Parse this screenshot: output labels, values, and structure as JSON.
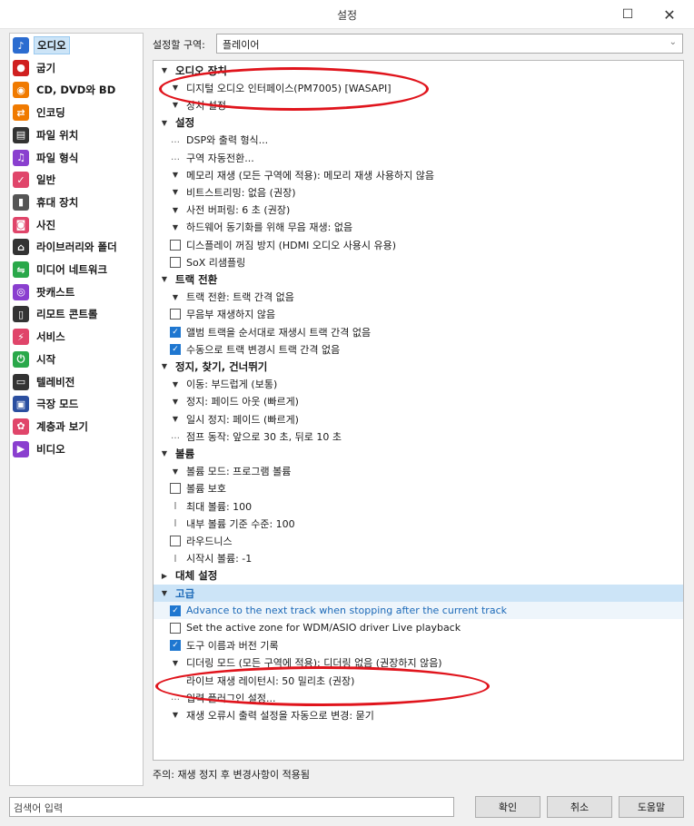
{
  "window": {
    "title": "설정",
    "maximize_icon": "☐",
    "close_icon": "✕"
  },
  "sidebar": {
    "items": [
      {
        "label": "오디오",
        "icon": "♪",
        "color": "#2b6cd0",
        "selected": true
      },
      {
        "label": "굽기",
        "icon": "●",
        "color": "#d02020"
      },
      {
        "label": "CD, DVD와 BD",
        "icon": "◉",
        "color": "#f07a00"
      },
      {
        "label": "인코딩",
        "icon": "⇄",
        "color": "#f07a00"
      },
      {
        "label": "파일 위치",
        "icon": "▤",
        "color": "#333333"
      },
      {
        "label": "파일 형식",
        "icon": "♫",
        "color": "#8a3fcf"
      },
      {
        "label": "일반",
        "icon": "✓",
        "color": "#e0456a"
      },
      {
        "label": "휴대 장치",
        "icon": "▮",
        "color": "#555555"
      },
      {
        "label": "사진",
        "icon": "◙",
        "color": "#e0456a"
      },
      {
        "label": "라이브러리와 폴더",
        "icon": "⌂",
        "color": "#333333"
      },
      {
        "label": "미디어 네트워크",
        "icon": "⇋",
        "color": "#2aa84a"
      },
      {
        "label": "팟캐스트",
        "icon": "◎",
        "color": "#8a3fcf"
      },
      {
        "label": "리모트 콘트롤",
        "icon": "▯",
        "color": "#333333"
      },
      {
        "label": "서비스",
        "icon": "⚡",
        "color": "#e0456a"
      },
      {
        "label": "시작",
        "icon": "⏻",
        "color": "#2aa84a"
      },
      {
        "label": "텔레비전",
        "icon": "▭",
        "color": "#333333"
      },
      {
        "label": "극장 모드",
        "icon": "▣",
        "color": "#2b4fa0"
      },
      {
        "label": "계층과 보기",
        "icon": "✿",
        "color": "#e0456a"
      },
      {
        "label": "비디오",
        "icon": "▶",
        "color": "#8a3fcf"
      }
    ]
  },
  "zone": {
    "label": "설정할 구역:",
    "value": "플레이어"
  },
  "tree": [
    {
      "kind": "group",
      "label": "오디오 장치",
      "toggle": "▼"
    },
    {
      "kind": "item",
      "marker": "arrow",
      "label": "디지털 오디오 인터페이스(PM7005) [WASAPI]"
    },
    {
      "kind": "item",
      "marker": "arrow",
      "label": "장치 설정"
    },
    {
      "kind": "group",
      "label": "설정",
      "toggle": "▼"
    },
    {
      "kind": "item",
      "marker": "dots",
      "label": "DSP와 출력 형식..."
    },
    {
      "kind": "item",
      "marker": "dots",
      "label": "구역 자동전환..."
    },
    {
      "kind": "item",
      "marker": "arrow",
      "label": "메모리 재생 (모든 구역에 적용): 메모리 재생 사용하지 않음"
    },
    {
      "kind": "item",
      "marker": "arrow",
      "label": "비트스트리밍: 없음 (권장)"
    },
    {
      "kind": "item",
      "marker": "arrow",
      "label": "사전 버퍼링: 6 초 (권장)"
    },
    {
      "kind": "item",
      "marker": "arrow",
      "label": "하드웨어 동기화를 위해 무음 재생: 없음"
    },
    {
      "kind": "item",
      "marker": "check",
      "checked": false,
      "label": "디스플레이 꺼짐 방지 (HDMI 오디오 사용시 유용)"
    },
    {
      "kind": "item",
      "marker": "check",
      "checked": false,
      "label": "SoX 리샘플링"
    },
    {
      "kind": "group",
      "label": "트랙 전환",
      "toggle": "▼"
    },
    {
      "kind": "item",
      "marker": "arrow",
      "label": "트랙 전환: 트랙 간격 없음"
    },
    {
      "kind": "item",
      "marker": "check",
      "checked": false,
      "label": "무음부 재생하지 않음"
    },
    {
      "kind": "item",
      "marker": "check",
      "checked": true,
      "label": "앨범 트랙을 순서대로 재생시 트랙 간격 없음"
    },
    {
      "kind": "item",
      "marker": "check",
      "checked": true,
      "label": "수동으로 트랙 변경시 트랙 간격 없음"
    },
    {
      "kind": "group",
      "label": "정지, 찾기, 건너뛰기",
      "toggle": "▼"
    },
    {
      "kind": "item",
      "marker": "arrow",
      "label": "이동: 부드럽게 (보통)"
    },
    {
      "kind": "item",
      "marker": "arrow",
      "label": "정지: 페이드 아웃 (빠르게)"
    },
    {
      "kind": "item",
      "marker": "arrow",
      "label": "일시 정지: 페이드 (빠르게)"
    },
    {
      "kind": "item",
      "marker": "dots",
      "label": "점프 동작: 앞으로 30 초, 뒤로 10 초"
    },
    {
      "kind": "group",
      "label": "볼륨",
      "toggle": "▼"
    },
    {
      "kind": "item",
      "marker": "arrow",
      "label": "볼륨 모드: 프로그램 볼륨"
    },
    {
      "kind": "item",
      "marker": "check",
      "checked": false,
      "label": "볼륨 보호"
    },
    {
      "kind": "item",
      "marker": "ibeam",
      "label": "최대 볼륨: 100"
    },
    {
      "kind": "item",
      "marker": "ibeam",
      "label": "내부 볼륨 기준 수준: 100"
    },
    {
      "kind": "item",
      "marker": "check",
      "checked": false,
      "label": "라우드니스"
    },
    {
      "kind": "item",
      "marker": "ibeam",
      "label": "시작시 볼륨: -1"
    },
    {
      "kind": "group",
      "label": "대체 설정",
      "toggle": "▶"
    },
    {
      "kind": "group",
      "label": "고급",
      "toggle": "▼",
      "highlight": "hl",
      "blue": true
    },
    {
      "kind": "item",
      "marker": "check",
      "checked": true,
      "label": "Advance to the next track when stopping after the current track",
      "highlight": "sub",
      "blue": true
    },
    {
      "kind": "item",
      "marker": "check",
      "checked": false,
      "label": "Set the active zone for WDM/ASIO driver Live playback"
    },
    {
      "kind": "item",
      "marker": "check",
      "checked": true,
      "label": "도구 이름과 버전 기록"
    },
    {
      "kind": "item",
      "marker": "arrow",
      "label": "디더링 모드 (모든 구역에 적용): 디더링 없음 (권장하지 않음)"
    },
    {
      "kind": "item",
      "marker": "none",
      "label": "라이브 재생 레이턴시: 50 밀리초 (권장)"
    },
    {
      "kind": "item",
      "marker": "dots",
      "label": "입력 플러그인 설정..."
    },
    {
      "kind": "item",
      "marker": "arrow",
      "label": "재생 오류시 출력 설정을 자동으로 변경: 묻기"
    }
  ],
  "note": "주의: 재생 정지 후 변경사항이 적용됨",
  "search": {
    "placeholder": "검색어 입력"
  },
  "buttons": {
    "ok": "확인",
    "cancel": "취소",
    "help": "도움말"
  },
  "annotations": {
    "color": "#e0141c"
  }
}
